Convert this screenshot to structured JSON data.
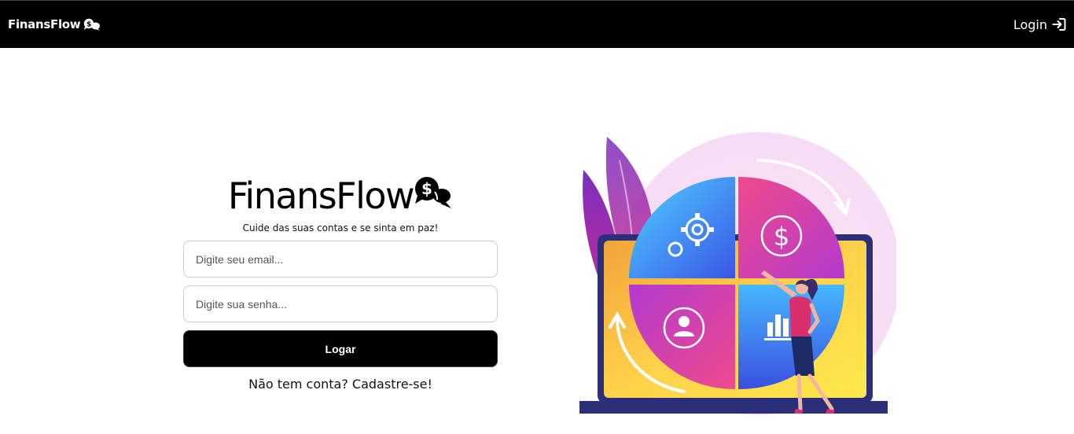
{
  "navbar": {
    "brand": "FinansFlow",
    "login_label": "Login"
  },
  "login": {
    "logo_text": "FinansFlow",
    "tagline": "Cuide das suas contas e se sinta em paz!",
    "email_placeholder": "Digite seu email...",
    "password_placeholder": "Digite sua senha...",
    "submit_label": "Logar",
    "signup_text": "Não tem conta? Cadastre-se!"
  },
  "icons": {
    "brand": "money-chat-icon",
    "login": "login-arrow-icon",
    "logo": "money-chat-icon"
  },
  "colors": {
    "navbar_bg": "#000000",
    "button_bg": "#000000",
    "accent_pink": "#E040A0",
    "accent_blue": "#3F7BFF",
    "accent_yellow": "#FFD84A"
  }
}
